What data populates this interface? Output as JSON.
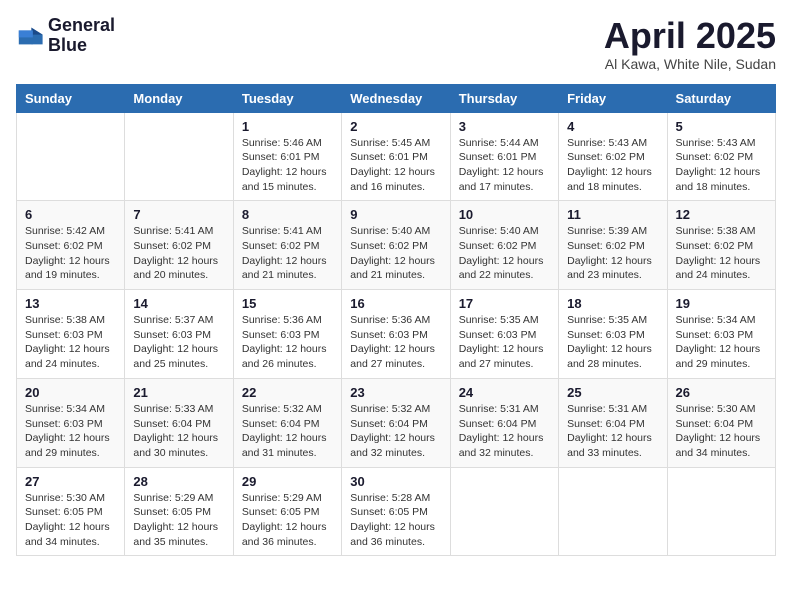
{
  "logo": {
    "line1": "General",
    "line2": "Blue"
  },
  "title": "April 2025",
  "subtitle": "Al Kawa, White Nile, Sudan",
  "weekdays": [
    "Sunday",
    "Monday",
    "Tuesday",
    "Wednesday",
    "Thursday",
    "Friday",
    "Saturday"
  ],
  "weeks": [
    [
      {
        "day": null
      },
      {
        "day": null
      },
      {
        "day": "1",
        "sunrise": "5:46 AM",
        "sunset": "6:01 PM",
        "daylight": "12 hours and 15 minutes."
      },
      {
        "day": "2",
        "sunrise": "5:45 AM",
        "sunset": "6:01 PM",
        "daylight": "12 hours and 16 minutes."
      },
      {
        "day": "3",
        "sunrise": "5:44 AM",
        "sunset": "6:01 PM",
        "daylight": "12 hours and 17 minutes."
      },
      {
        "day": "4",
        "sunrise": "5:43 AM",
        "sunset": "6:02 PM",
        "daylight": "12 hours and 18 minutes."
      },
      {
        "day": "5",
        "sunrise": "5:43 AM",
        "sunset": "6:02 PM",
        "daylight": "12 hours and 18 minutes."
      }
    ],
    [
      {
        "day": "6",
        "sunrise": "5:42 AM",
        "sunset": "6:02 PM",
        "daylight": "12 hours and 19 minutes."
      },
      {
        "day": "7",
        "sunrise": "5:41 AM",
        "sunset": "6:02 PM",
        "daylight": "12 hours and 20 minutes."
      },
      {
        "day": "8",
        "sunrise": "5:41 AM",
        "sunset": "6:02 PM",
        "daylight": "12 hours and 21 minutes."
      },
      {
        "day": "9",
        "sunrise": "5:40 AM",
        "sunset": "6:02 PM",
        "daylight": "12 hours and 21 minutes."
      },
      {
        "day": "10",
        "sunrise": "5:40 AM",
        "sunset": "6:02 PM",
        "daylight": "12 hours and 22 minutes."
      },
      {
        "day": "11",
        "sunrise": "5:39 AM",
        "sunset": "6:02 PM",
        "daylight": "12 hours and 23 minutes."
      },
      {
        "day": "12",
        "sunrise": "5:38 AM",
        "sunset": "6:02 PM",
        "daylight": "12 hours and 24 minutes."
      }
    ],
    [
      {
        "day": "13",
        "sunrise": "5:38 AM",
        "sunset": "6:03 PM",
        "daylight": "12 hours and 24 minutes."
      },
      {
        "day": "14",
        "sunrise": "5:37 AM",
        "sunset": "6:03 PM",
        "daylight": "12 hours and 25 minutes."
      },
      {
        "day": "15",
        "sunrise": "5:36 AM",
        "sunset": "6:03 PM",
        "daylight": "12 hours and 26 minutes."
      },
      {
        "day": "16",
        "sunrise": "5:36 AM",
        "sunset": "6:03 PM",
        "daylight": "12 hours and 27 minutes."
      },
      {
        "day": "17",
        "sunrise": "5:35 AM",
        "sunset": "6:03 PM",
        "daylight": "12 hours and 27 minutes."
      },
      {
        "day": "18",
        "sunrise": "5:35 AM",
        "sunset": "6:03 PM",
        "daylight": "12 hours and 28 minutes."
      },
      {
        "day": "19",
        "sunrise": "5:34 AM",
        "sunset": "6:03 PM",
        "daylight": "12 hours and 29 minutes."
      }
    ],
    [
      {
        "day": "20",
        "sunrise": "5:34 AM",
        "sunset": "6:03 PM",
        "daylight": "12 hours and 29 minutes."
      },
      {
        "day": "21",
        "sunrise": "5:33 AM",
        "sunset": "6:04 PM",
        "daylight": "12 hours and 30 minutes."
      },
      {
        "day": "22",
        "sunrise": "5:32 AM",
        "sunset": "6:04 PM",
        "daylight": "12 hours and 31 minutes."
      },
      {
        "day": "23",
        "sunrise": "5:32 AM",
        "sunset": "6:04 PM",
        "daylight": "12 hours and 32 minutes."
      },
      {
        "day": "24",
        "sunrise": "5:31 AM",
        "sunset": "6:04 PM",
        "daylight": "12 hours and 32 minutes."
      },
      {
        "day": "25",
        "sunrise": "5:31 AM",
        "sunset": "6:04 PM",
        "daylight": "12 hours and 33 minutes."
      },
      {
        "day": "26",
        "sunrise": "5:30 AM",
        "sunset": "6:04 PM",
        "daylight": "12 hours and 34 minutes."
      }
    ],
    [
      {
        "day": "27",
        "sunrise": "5:30 AM",
        "sunset": "6:05 PM",
        "daylight": "12 hours and 34 minutes."
      },
      {
        "day": "28",
        "sunrise": "5:29 AM",
        "sunset": "6:05 PM",
        "daylight": "12 hours and 35 minutes."
      },
      {
        "day": "29",
        "sunrise": "5:29 AM",
        "sunset": "6:05 PM",
        "daylight": "12 hours and 36 minutes."
      },
      {
        "day": "30",
        "sunrise": "5:28 AM",
        "sunset": "6:05 PM",
        "daylight": "12 hours and 36 minutes."
      },
      {
        "day": null
      },
      {
        "day": null
      },
      {
        "day": null
      }
    ]
  ]
}
